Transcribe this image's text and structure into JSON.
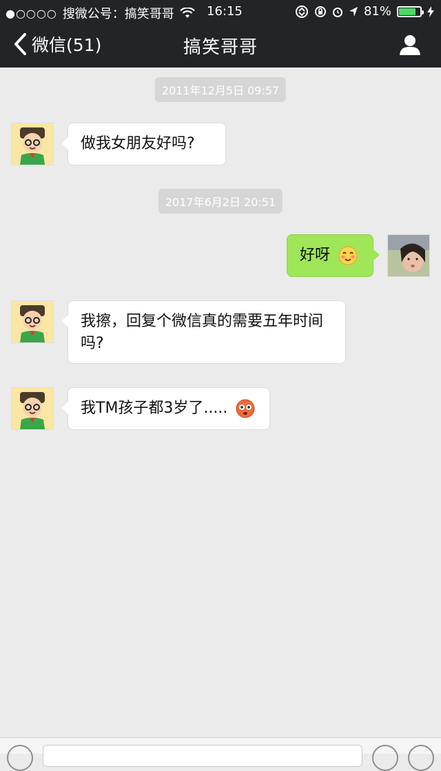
{
  "status_bar": {
    "signal": "●○○○○",
    "carrier": "搜微公号：搞笑哥哥",
    "time": "16:15",
    "battery_percent": "81%",
    "battery_level": 0.81
  },
  "nav": {
    "back_label": "微信(51)",
    "title": "搞笑哥哥"
  },
  "messages": [
    {
      "kind": "timestamp",
      "text": "2011年12月5日 09:57"
    },
    {
      "kind": "incoming",
      "text": "做我女朋友好吗?"
    },
    {
      "kind": "timestamp",
      "text": "2017年6月2日 20:51"
    },
    {
      "kind": "outgoing",
      "text": "好呀",
      "emoji": "blush-emoji"
    },
    {
      "kind": "incoming",
      "text": "我擦，回复个微信真的需要五年时间吗?"
    },
    {
      "kind": "incoming",
      "text": "我TM孩子都3岁了.....",
      "emoji": "flushed-emoji"
    }
  ],
  "colors": {
    "topbar": "#222427",
    "background": "#ebebeb",
    "outgoing_bubble": "#9fe658",
    "incoming_bubble": "#ffffff",
    "timestamp_bg": "#d6d6d6"
  }
}
